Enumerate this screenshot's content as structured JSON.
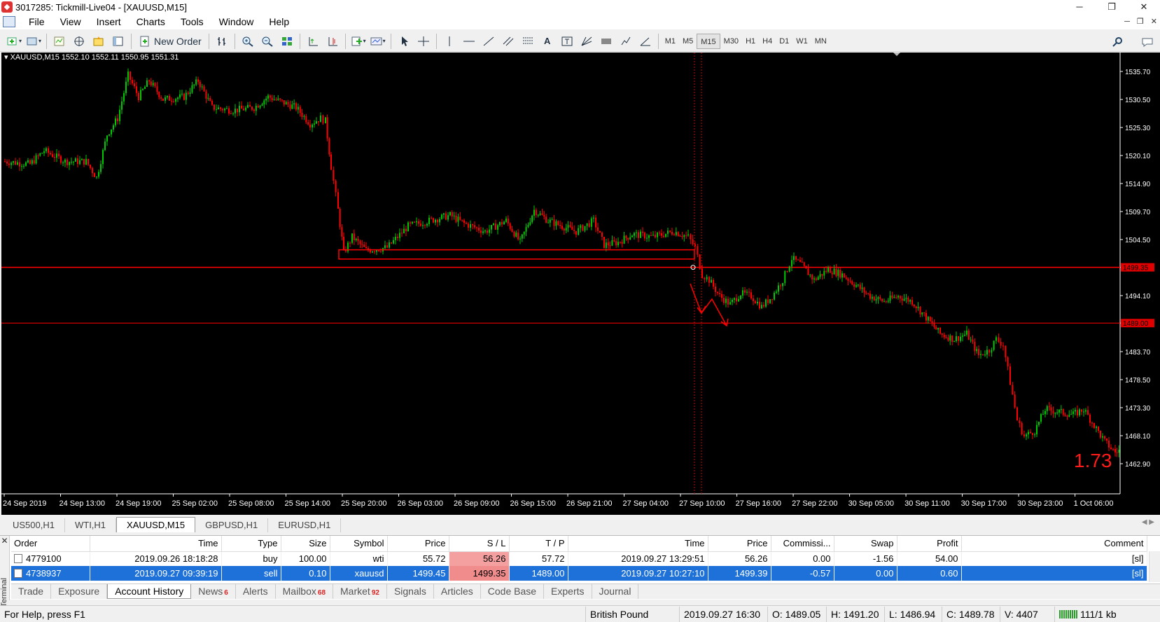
{
  "window": {
    "title": "3017285: Tickmill-Live04 - [XAUUSD,M15]"
  },
  "menu": [
    "File",
    "View",
    "Insert",
    "Charts",
    "Tools",
    "Window",
    "Help"
  ],
  "toolbar": {
    "new_order_label": "New Order",
    "timeframes": [
      "M1",
      "M5",
      "M15",
      "M30",
      "H1",
      "H4",
      "D1",
      "W1",
      "MN"
    ],
    "active_timeframe": "M15"
  },
  "chart": {
    "header": "XAUUSD,M15",
    "ohlc": "1552.10 1552.11 1550.95 1551.31",
    "price_labels": [
      "1535.70",
      "1530.50",
      "1525.30",
      "1520.10",
      "1514.90",
      "1509.70",
      "1504.50",
      "1499.35",
      "1494.10",
      "1489.00",
      "1483.70",
      "1478.50",
      "1473.30",
      "1468.10",
      "1462.90"
    ],
    "time_labels": [
      "24 Sep 2019",
      "24 Sep 13:00",
      "24 Sep 19:00",
      "25 Sep 02:00",
      "25 Sep 08:00",
      "25 Sep 14:00",
      "25 Sep 20:00",
      "26 Sep 03:00",
      "26 Sep 09:00",
      "26 Sep 15:00",
      "26 Sep 21:00",
      "27 Sep 04:00",
      "27 Sep 10:00",
      "27 Sep 16:00",
      "27 Sep 22:00",
      "30 Sep 05:00",
      "30 Sep 11:00",
      "30 Sep 17:00",
      "30 Sep 23:00",
      "1 Oct 06:00"
    ],
    "hline_sl": "1499.35",
    "hline_tp": "1489.00",
    "profit_overlay": "1.73",
    "colors": {
      "bull": "#00c800",
      "bear": "#ff0000",
      "line": "#ff0000",
      "background": "#000000"
    }
  },
  "symbol_tabs": [
    "US500,H1",
    "WTI,H1",
    "XAUUSD,M15",
    "GBPUSD,H1",
    "EURUSD,H1"
  ],
  "active_symbol_tab": "XAUUSD,M15",
  "history": {
    "columns": [
      "Order",
      "Time",
      "Type",
      "Size",
      "Symbol",
      "Price",
      "S / L",
      "T / P",
      "Time",
      "Price",
      "Commissi...",
      "Swap",
      "Profit",
      "Comment"
    ],
    "rows": [
      [
        "4779100",
        "2019.09.26 18:18:28",
        "buy",
        "100.00",
        "wti",
        "55.72",
        "56.26",
        "57.72",
        "2019.09.27 13:29:51",
        "56.26",
        "0.00",
        "-1.56",
        "54.00",
        "[sl]"
      ],
      [
        "4738937",
        "2019.09.27 09:39:19",
        "sell",
        "0.10",
        "xauusd",
        "1499.45",
        "1499.35",
        "1489.00",
        "2019.09.27 10:27:10",
        "1499.39",
        "-0.57",
        "0.00",
        "0.60",
        "[sl]"
      ]
    ]
  },
  "terminal_label": "Terminal",
  "terminal_tabs": [
    {
      "label": "Trade",
      "badge": ""
    },
    {
      "label": "Exposure",
      "badge": ""
    },
    {
      "label": "Account History",
      "badge": ""
    },
    {
      "label": "News",
      "badge": "6"
    },
    {
      "label": "Alerts",
      "badge": ""
    },
    {
      "label": "Mailbox",
      "badge": "68"
    },
    {
      "label": "Market",
      "badge": "92"
    },
    {
      "label": "Signals",
      "badge": ""
    },
    {
      "label": "Articles",
      "badge": ""
    },
    {
      "label": "Code Base",
      "badge": ""
    },
    {
      "label": "Experts",
      "badge": ""
    },
    {
      "label": "Journal",
      "badge": ""
    }
  ],
  "status": {
    "help": "For Help, press F1",
    "profile": "British Pound",
    "datetime": "2019.09.27 16:30",
    "open": "O: 1489.05",
    "high": "H: 1491.20",
    "low": "L: 1486.94",
    "close": "C: 1489.78",
    "volume": "V: 4407",
    "traffic": "111/1 kb"
  }
}
